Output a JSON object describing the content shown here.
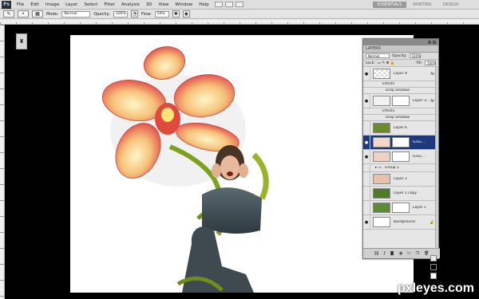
{
  "menubar": {
    "logo": "Ps",
    "items": [
      "File",
      "Edit",
      "Image",
      "Layer",
      "Select",
      "Filter",
      "Analysis",
      "3D",
      "View",
      "Window",
      "Help"
    ],
    "workspaces": [
      "ESSENTIALS",
      "PAINTING",
      "DESIGN"
    ],
    "active_workspace": "ESSENTIALS"
  },
  "options": {
    "mode_label": "Mode:",
    "mode_value": "Normal",
    "opacity_label": "Opacity:",
    "opacity_value": "100%",
    "flow_label": "Flow:",
    "flow_value": "50%"
  },
  "layers_panel": {
    "tab": "LAYERS",
    "blend_mode": "Normal",
    "opacity_label": "Opacity:",
    "opacity_value": "100%",
    "lock_label": "Lock:",
    "fill_label": "Fill:",
    "fill_value": "100%",
    "layers": [
      {
        "name": "Layer 9",
        "fx": "fx"
      },
      {
        "name": "Effects",
        "sub": true
      },
      {
        "name": "Drop Shadow",
        "sub": true
      },
      {
        "name": "Layer 3...",
        "fx": "fx"
      },
      {
        "name": "Effects",
        "sub": true
      },
      {
        "name": "Drop Shadow",
        "sub": true
      },
      {
        "name": "Layer 6"
      },
      {
        "name": "Grou...",
        "selected": true
      },
      {
        "name": "Grou..."
      },
      {
        "name": "Group 1"
      },
      {
        "name": "Layer 2"
      },
      {
        "name": "Layer 1 copy"
      },
      {
        "name": "Layer 1"
      },
      {
        "name": "Background"
      }
    ]
  },
  "watermark": "pxleyes.com"
}
